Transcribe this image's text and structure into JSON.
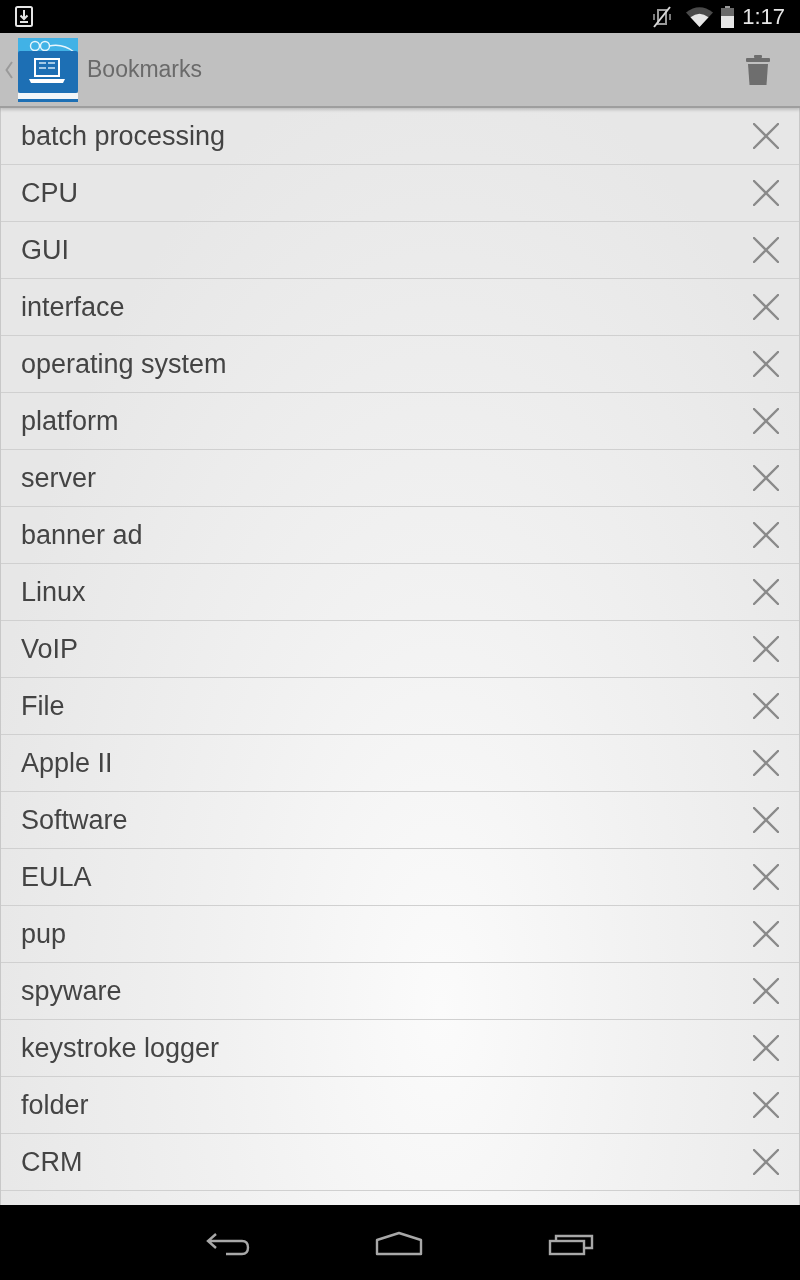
{
  "status_bar": {
    "time": "1:17"
  },
  "action_bar": {
    "title": "Bookmarks"
  },
  "bookmarks": [
    "batch processing",
    "CPU",
    "GUI",
    "interface",
    "operating system",
    "platform",
    "server",
    "banner ad",
    "Linux",
    "VoIP",
    "File",
    "Apple II",
    "Software",
    "EULA",
    "pup",
    "spyware",
    "keystroke logger",
    "folder",
    "CRM"
  ]
}
